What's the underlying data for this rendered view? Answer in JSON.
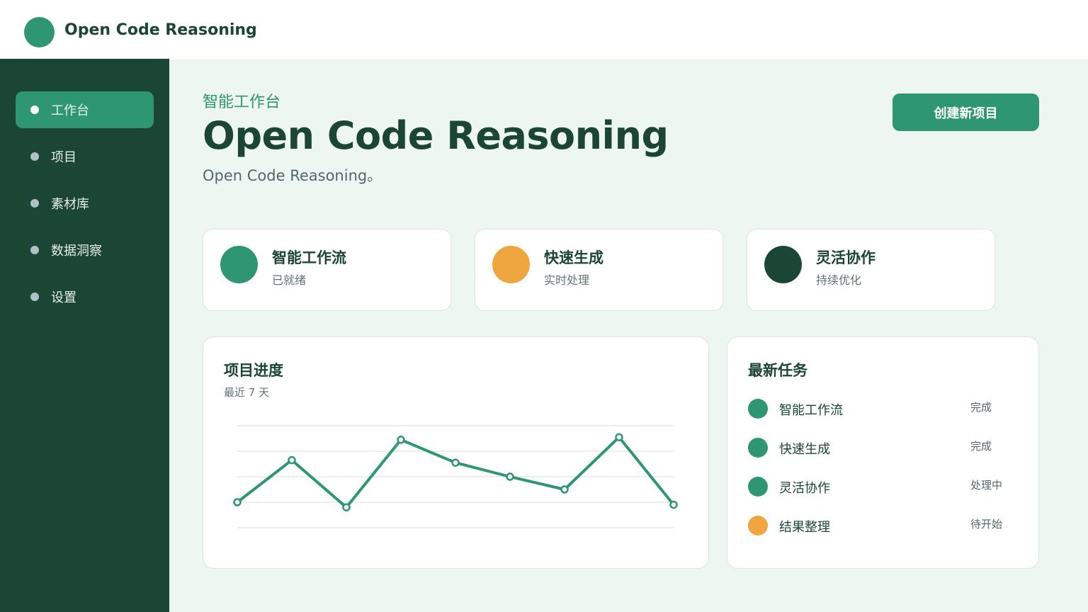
{
  "app": {
    "title": "Open Code Reasoning"
  },
  "colors": {
    "primary": "#2e9672",
    "dark": "#1b4535",
    "accent": "#f0a640",
    "background": "#eef6f2"
  },
  "sidebar": {
    "items": [
      {
        "label": "工作台",
        "active": true
      },
      {
        "label": "项目",
        "active": false
      },
      {
        "label": "素材库",
        "active": false
      },
      {
        "label": "数据洞察",
        "active": false
      },
      {
        "label": "设置",
        "active": false
      }
    ]
  },
  "header": {
    "eyebrow": "智能工作台",
    "title": "Open Code Reasoning",
    "subtitle": "Open Code Reasoning。",
    "create_button": "创建新项目"
  },
  "stats": [
    {
      "title": "智能工作流",
      "sub": "已就绪",
      "color": "#2e9672"
    },
    {
      "title": "快速生成",
      "sub": "实时处理",
      "color": "#f0a640"
    },
    {
      "title": "灵活协作",
      "sub": "持续优化",
      "color": "#1b4535"
    }
  ],
  "progress": {
    "title": "项目进度",
    "subtitle": "最近 7 天"
  },
  "chart_data": {
    "type": "line",
    "title": "项目进度",
    "subtitle": "最近 7 天",
    "x": [
      1,
      2,
      3,
      4,
      5,
      6,
      7,
      8,
      9
    ],
    "values": [
      1.0,
      2.65,
      0.8,
      3.45,
      2.55,
      2.0,
      1.5,
      3.55,
      0.9
    ],
    "ylim": [
      0,
      4
    ],
    "grid": true,
    "color": "#2e9672"
  },
  "tasks": {
    "title": "最新任务",
    "items": [
      {
        "name": "智能工作流",
        "status": "完成",
        "color": "#2e9672"
      },
      {
        "name": "快速生成",
        "status": "完成",
        "color": "#2e9672"
      },
      {
        "name": "灵活协作",
        "status": "处理中",
        "color": "#2e9672"
      },
      {
        "name": "结果整理",
        "status": "待开始",
        "color": "#f0a640"
      }
    ]
  }
}
